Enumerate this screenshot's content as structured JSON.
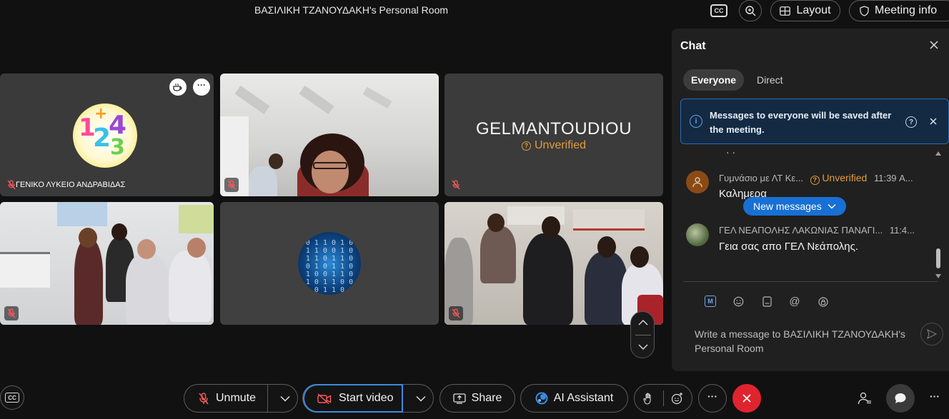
{
  "header": {
    "room_title": "ΒΑΣΙΛΙΚΗ ΤΖΑΝΟΥΔΑΚΗ's Personal Room",
    "cc_label": "CC",
    "layout_label": "Layout",
    "meeting_info_label": "Meeting info"
  },
  "tiles": [
    {
      "name": "ΓΕΝΙΚΟ ΛΥΚΕΙΟ ΑΝΔΡΑΒΙΔΑΣ",
      "muted": true
    },
    {
      "name": "",
      "muted": true
    },
    {
      "name": "GELMANTOUDIOU",
      "status": "Unverified",
      "muted": true
    },
    {
      "name": "",
      "muted": true
    },
    {
      "name": "",
      "muted": false
    },
    {
      "name": "",
      "muted": true
    }
  ],
  "chat": {
    "title": "Chat",
    "tabs": [
      "Everyone",
      "Direct"
    ],
    "notice": "Messages to everyone will be saved after the meeting.",
    "messages": [
      {
        "sender": "Γυμνάσιο με ΛΤ Κε...",
        "status": "Unverified",
        "time": "11:39 Α...",
        "text": "Καλημερα"
      },
      {
        "sender": "ΓΕΛ ΝΕΑΠΟΛΗΣ ΛΑΚΩΝΙΑΣ ΠΑΝΑΓΙ...",
        "status": "",
        "time": "11:4...",
        "text": "Γεια σας απο ΓΕΛ Νεάπολης."
      }
    ],
    "new_messages_label": "New messages",
    "compose_placeholder": "Write a message to ΒΑΣΙΛΙΚΗ ΤΖΑΝΟΥΔΑΚΗ's Personal Room"
  },
  "controls": {
    "unmute_label": "Unmute",
    "start_video_label": "Start video",
    "share_label": "Share",
    "ai_assistant_label": "AI Assistant"
  },
  "colors": {
    "background": "#111111",
    "chat_panel": "#202020",
    "accent_blue": "#1870d5",
    "end_call_red": "#e0242f",
    "unverified_orange": "#e39b3a"
  }
}
